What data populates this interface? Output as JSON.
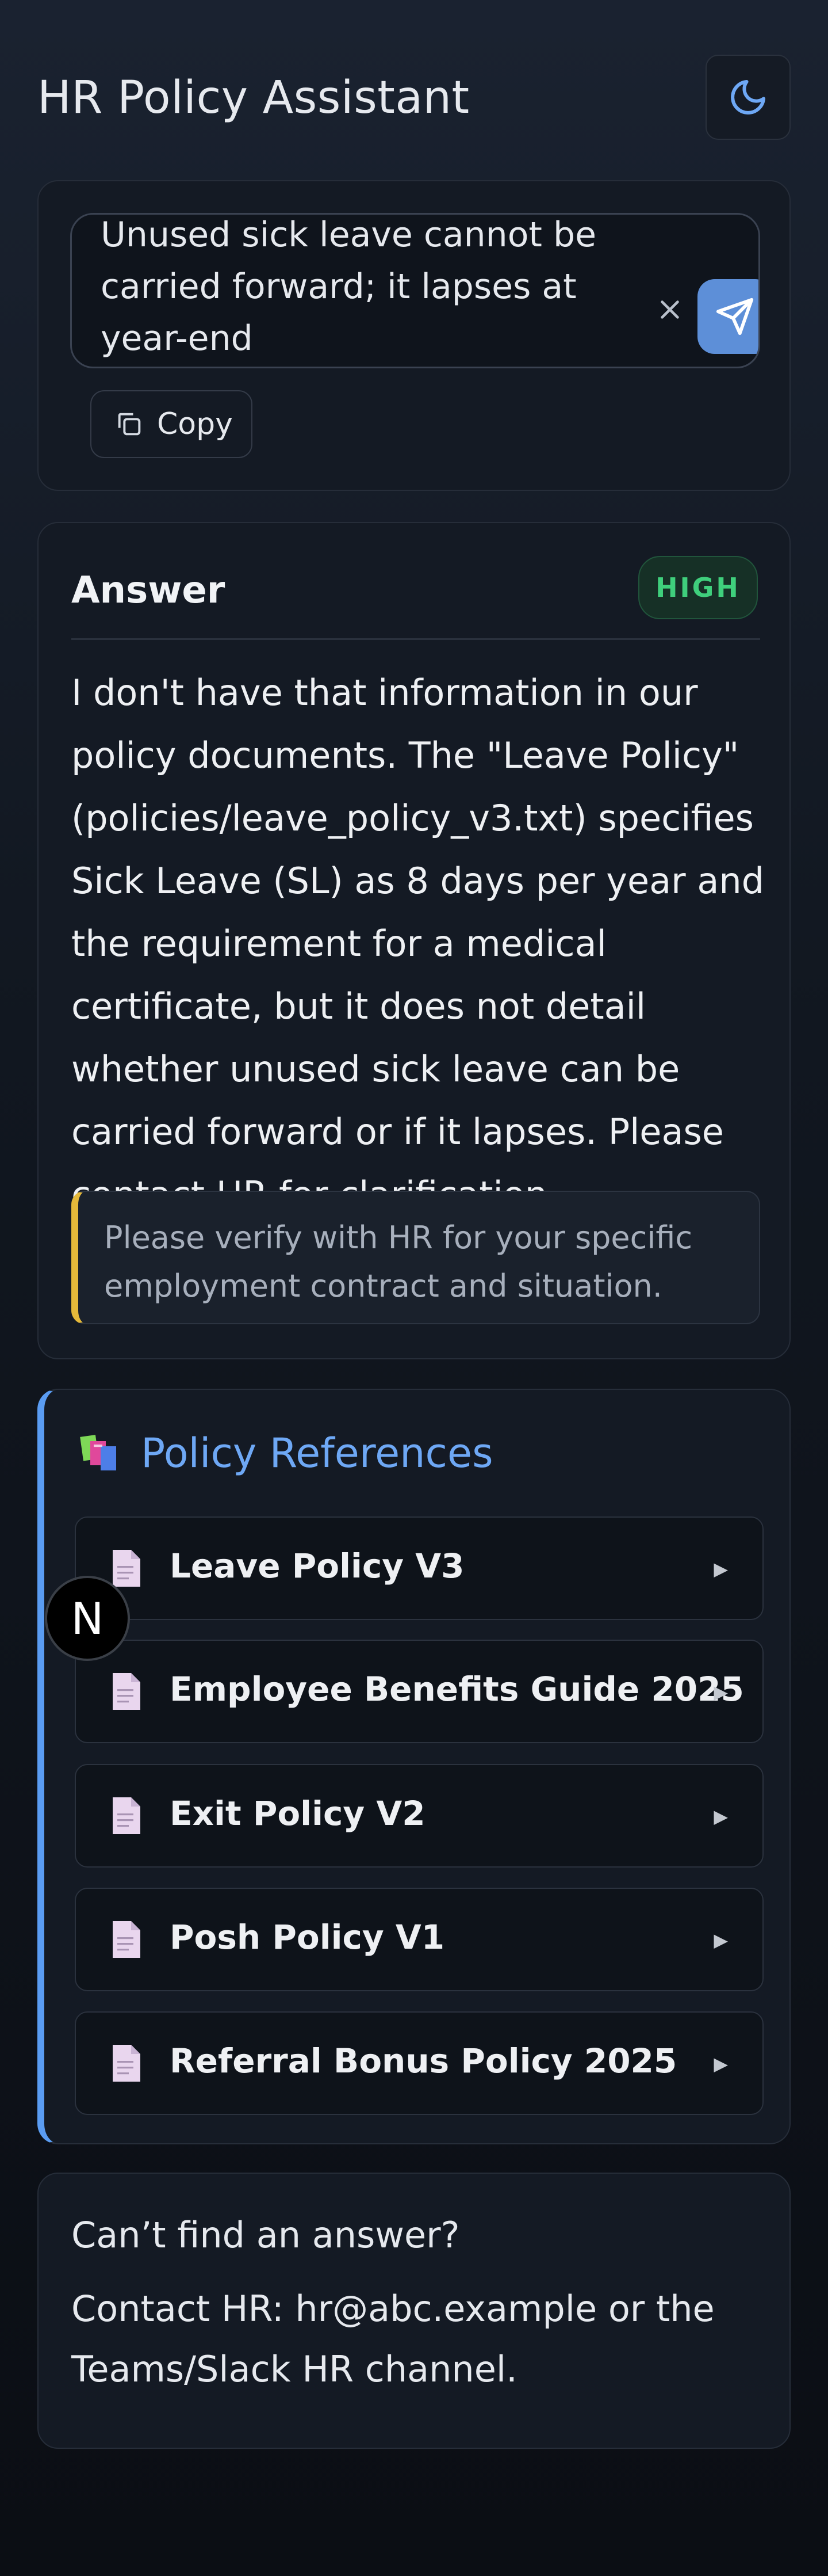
{
  "header": {
    "title": "HR Policy Assistant",
    "theme_icon": "moon-icon"
  },
  "ask": {
    "input_value": "Unused sick leave cannot be carried forward; it lapses at year-end",
    "clear_icon": "close-icon",
    "send_icon": "send-icon",
    "copy_label": "Copy"
  },
  "answer": {
    "title": "Answer",
    "confidence": "HIGH",
    "body": "I don't have that information in our policy documents. The \"Leave Policy\" (policies/leave_policy_v3.txt) specifies Sick Leave (SL) as 8 days per year and the requirement for a medical certificate, but it does not detail whether unused sick leave can be carried forward or if it lapses. Please contact HR for clarification.",
    "disclaimer": "Please verify with HR for your specific employment contract and situation."
  },
  "references": {
    "title": "Policy References",
    "items": [
      {
        "label": "Leave Policy V3"
      },
      {
        "label": "Employee Benefits Guide 2025"
      },
      {
        "label": "Exit Policy V2"
      },
      {
        "label": "Posh Policy V1"
      },
      {
        "label": "Referral Bonus Policy 2025"
      }
    ]
  },
  "overlay": {
    "badge_letter": "N"
  },
  "help": {
    "title": "Can’t find an answer?",
    "text": "Contact HR: hr@abc.example or the Teams/Slack HR channel."
  },
  "colors": {
    "accent": "#5a9cf2",
    "send_button": "#5d8fd8",
    "badge_high": "#3fcf7c",
    "disclaimer_bar": "#e5b93a"
  }
}
